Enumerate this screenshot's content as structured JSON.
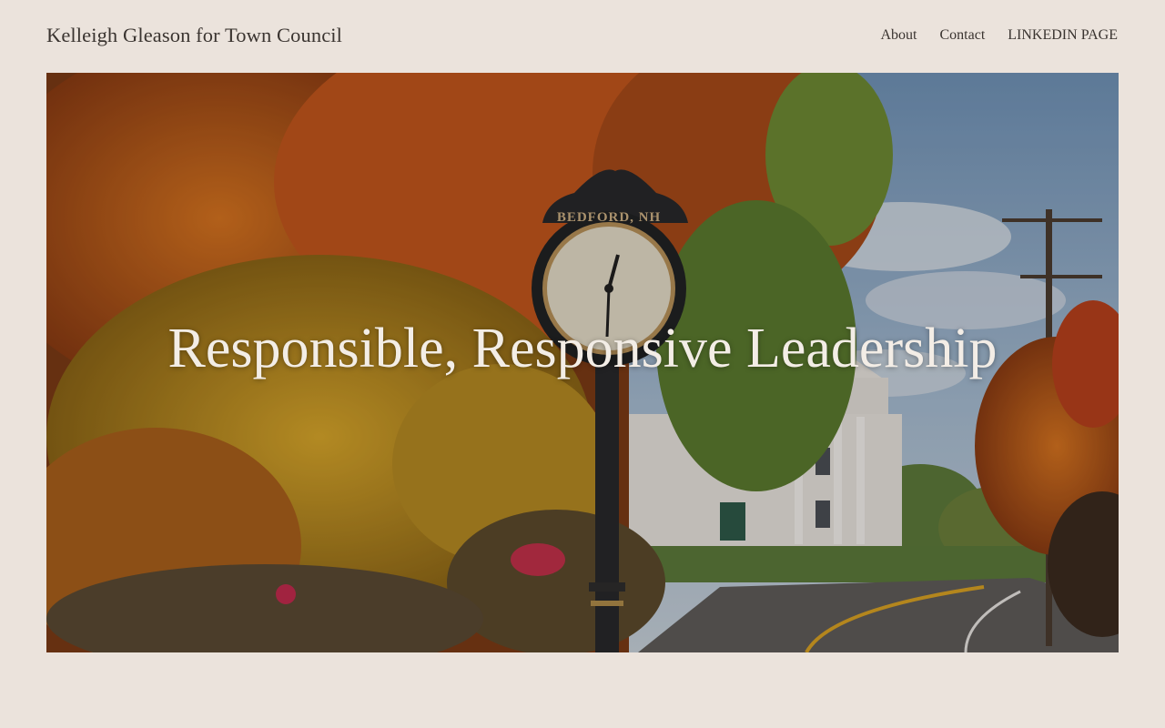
{
  "header": {
    "site_title": "Kelleigh Gleason for Town Council",
    "nav": [
      {
        "label": "About"
      },
      {
        "label": "Contact"
      },
      {
        "label": "LINKEDIN PAGE"
      }
    ]
  },
  "hero": {
    "heading": "Responsible, Responsive Leadership",
    "clock_sign": "BEDFORD, NH"
  },
  "colors": {
    "page_background": "#ebe3dc",
    "text": "#3a3430",
    "hero_text": "#f3ede6"
  }
}
